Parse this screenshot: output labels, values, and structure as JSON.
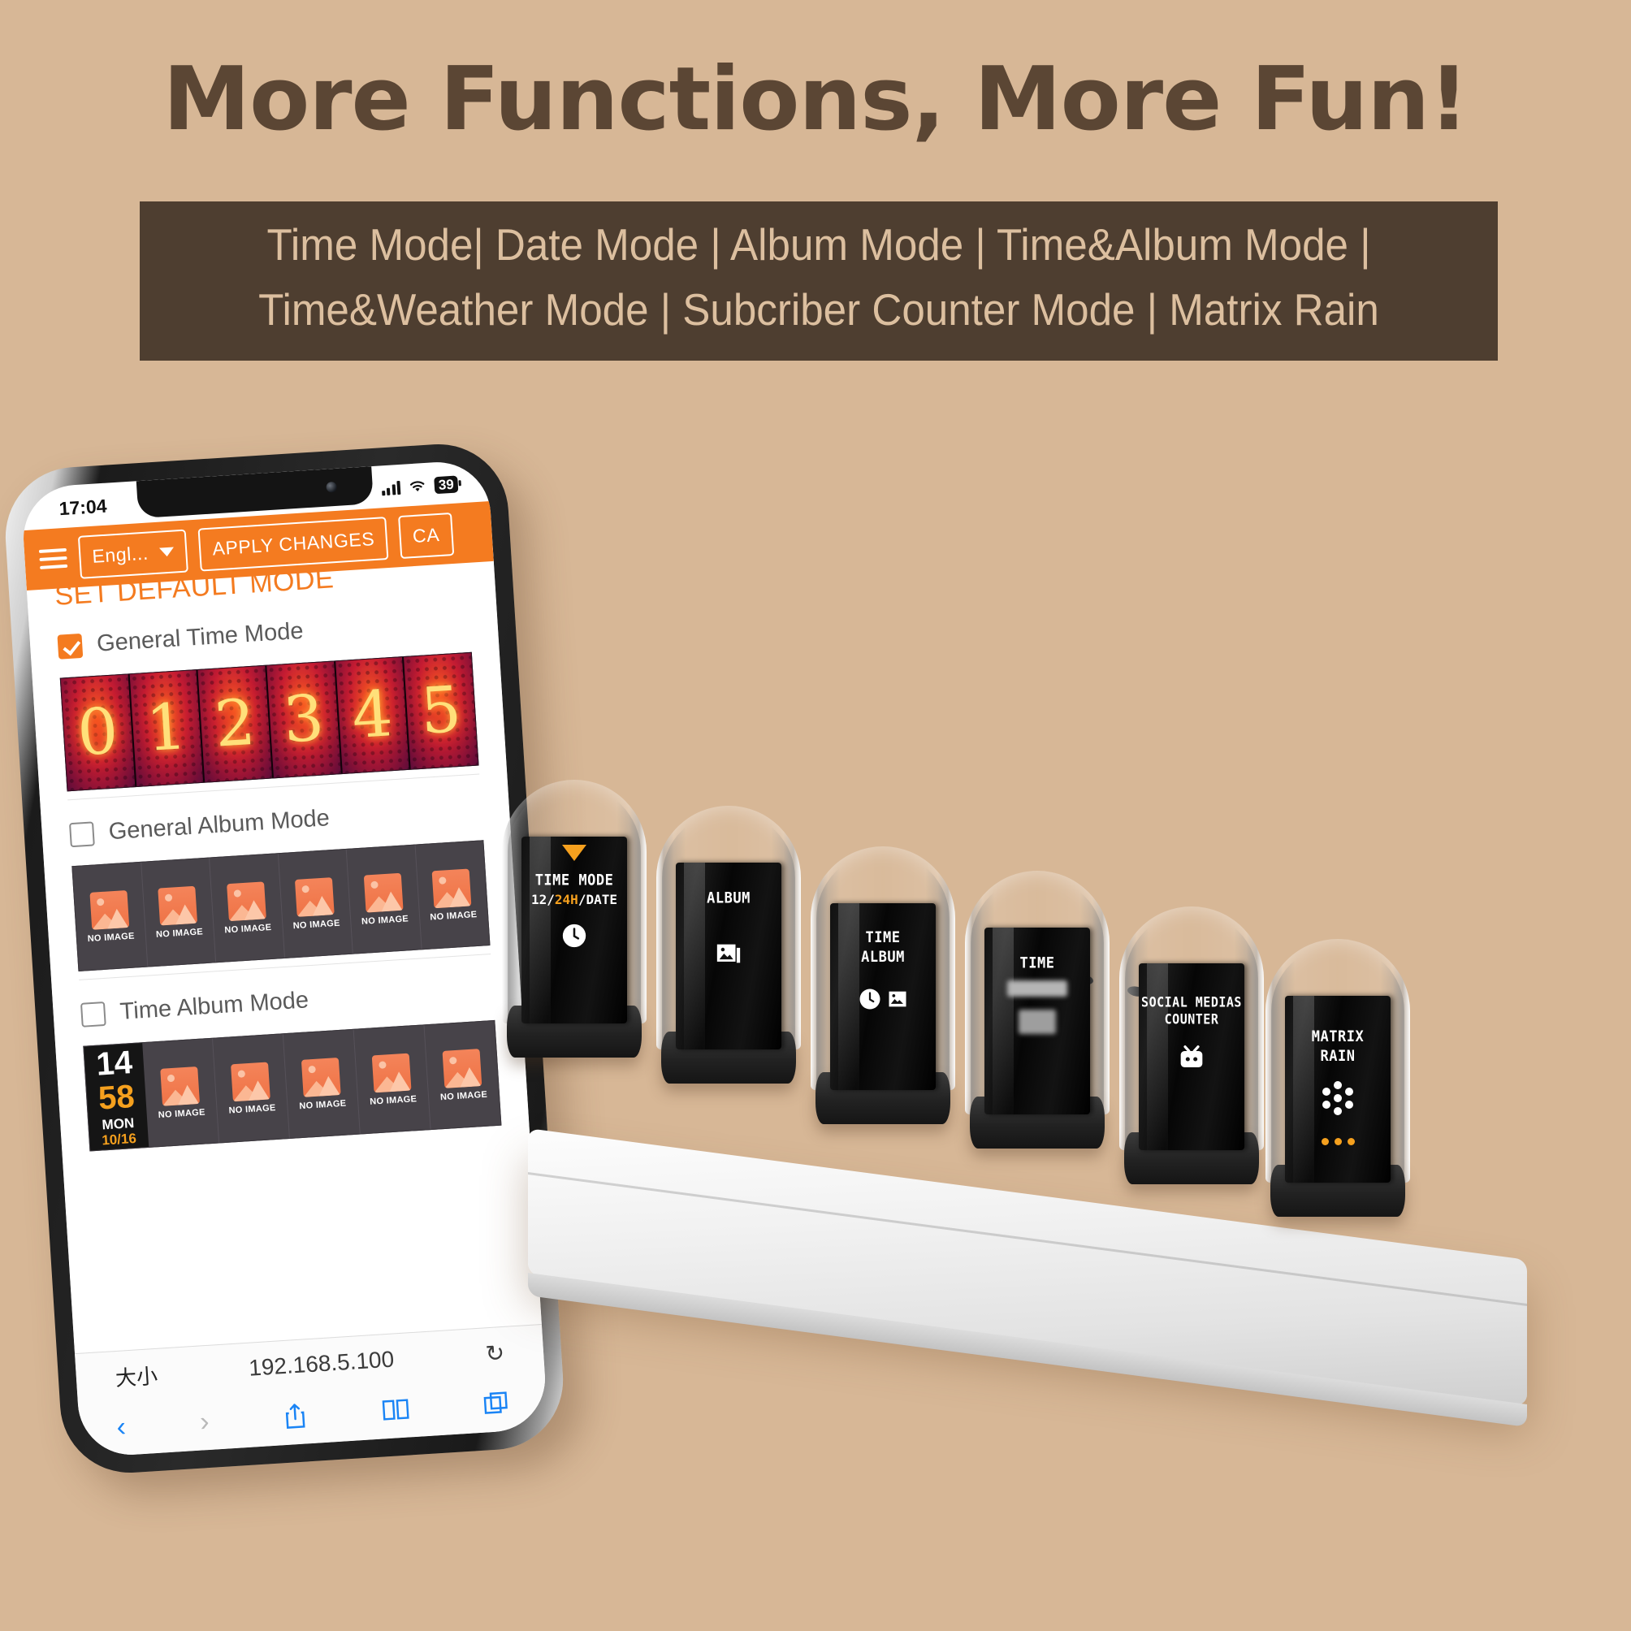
{
  "headline": "More Functions, More Fun!",
  "subtitle": {
    "line1": "Time Mode| Date Mode | Album Mode | Time&Album Mode |",
    "line2": "Time&Weather Mode | Subcriber Counter Mode | Matrix Rain"
  },
  "colors": {
    "background": "#d7b796",
    "headline": "#5b4634",
    "band": "#4e3e30",
    "band_text": "#dcbf9f",
    "accent_orange": "#f47b20",
    "clock_amber": "#f5a01e"
  },
  "phone": {
    "status": {
      "time": "17:04",
      "signal_icon": "signal-bars-icon",
      "wifi_icon": "wifi-icon",
      "battery_level": "39"
    },
    "appbar": {
      "menu_icon": "hamburger-menu-icon",
      "language_value": "Engl...",
      "dropdown_icon": "chevron-down-icon",
      "apply_label": "APPLY CHANGES",
      "cancel_label": "CA"
    },
    "section_title": "SET DEFAULT MODE",
    "modes": [
      {
        "label": "General Time Mode",
        "checked": true
      },
      {
        "label": "General Album Mode",
        "checked": false
      },
      {
        "label": "Time Album Mode",
        "checked": false
      }
    ],
    "nixie_digits": [
      "0",
      "1",
      "2",
      "3",
      "4",
      "5"
    ],
    "album_placeholder": "NO IMAGE",
    "album_cell_count": 6,
    "time_album_cell_count": 5,
    "clock_widget": {
      "hours": "14",
      "minutes": "58",
      "weekday": "MON",
      "date": "10/16"
    },
    "browser": {
      "font_size_label": "大小",
      "url": "192.168.5.100",
      "reload_icon": "reload-icon",
      "back_icon": "chevron-left-icon",
      "forward_icon": "chevron-right-icon",
      "share_icon": "share-icon",
      "bookmarks_icon": "book-icon",
      "tabs_icon": "tabs-icon"
    }
  },
  "device": {
    "tubes": [
      {
        "title": "TIME MODE",
        "sub_pre": "12/",
        "sub_hl": "24H",
        "sub_post": "/DATE",
        "icon": "clock-icon",
        "marker": "triangle-down-icon"
      },
      {
        "title": "ALBUM",
        "sub_pre": "",
        "sub_hl": "",
        "sub_post": "",
        "icon": "photo-icon",
        "marker": ""
      },
      {
        "title": "TIME\nALBUM",
        "sub_pre": "",
        "sub_hl": "",
        "sub_post": "",
        "icon": "clock-photo-icon",
        "marker": ""
      },
      {
        "title": "TIME",
        "sub_pre": "",
        "sub_hl": "",
        "sub_post": "",
        "icon": "blurred-weather-icon",
        "marker": ""
      },
      {
        "title": "SOCIAL MEDIAS\nCOUNTER",
        "sub_pre": "",
        "sub_hl": "",
        "sub_post": "",
        "icon": "bilibili-tv-icon",
        "marker": ""
      },
      {
        "title": "MATRIX\nRAIN",
        "sub_pre": "",
        "sub_hl": "",
        "sub_post": "",
        "icon": "dot-matrix-icon",
        "marker": "three-dots"
      }
    ]
  }
}
